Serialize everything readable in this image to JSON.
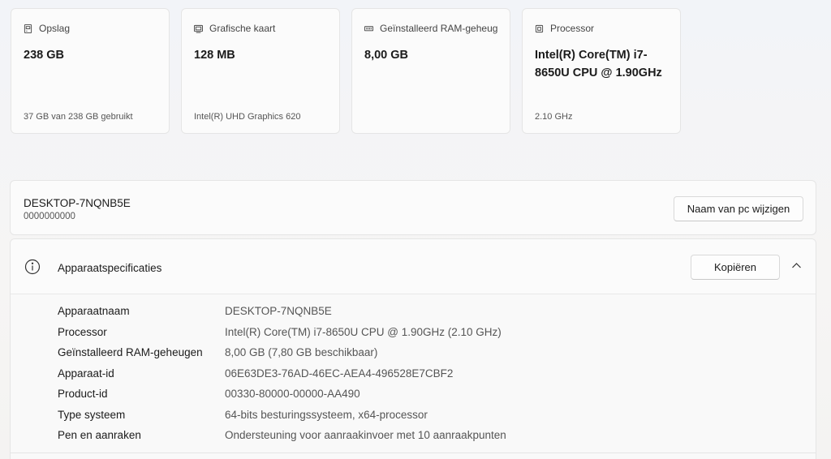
{
  "cards": [
    {
      "icon": "storage-icon",
      "title": "Opslag",
      "value": "238 GB",
      "sub": "37 GB van 238 GB gebruikt"
    },
    {
      "icon": "graphics-card-icon",
      "title": "Grafische kaart",
      "value": "128 MB",
      "sub": "Intel(R) UHD Graphics 620"
    },
    {
      "icon": "ram-icon",
      "title": "Geïnstalleerd RAM-geheug",
      "value": "8,00 GB",
      "sub": ""
    },
    {
      "icon": "processor-icon",
      "title": "Processor",
      "value": "Intel(R) Core(TM) i7-8650U CPU @ 1.90GHz",
      "sub": "2.10 GHz"
    }
  ],
  "pc": {
    "name": "DESKTOP-7NQNB5E",
    "id": "0000000000",
    "rename_label": "Naam van pc wijzigen"
  },
  "specs": {
    "title": "Apparaatspecificaties",
    "copy_label": "Kopiëren",
    "rows": [
      {
        "label": "Apparaatnaam",
        "value": "DESKTOP-7NQNB5E"
      },
      {
        "label": "Processor",
        "value": "Intel(R) Core(TM) i7-8650U CPU @ 1.90GHz (2.10 GHz)"
      },
      {
        "label": "Geïnstalleerd RAM-geheugen",
        "value": "8,00 GB (7,80 GB beschikbaar)"
      },
      {
        "label": "Apparaat-id",
        "value": "06E63DE3-76AD-46EC-AEA4-496528E7CBF2"
      },
      {
        "label": "Product-id",
        "value": "00330-80000-00000-AA490"
      },
      {
        "label": "Type systeem",
        "value": "64-bits besturingssysteem, x64-processor"
      },
      {
        "label": "Pen en aanraken",
        "value": "Ondersteuning voor aanraakinvoer met 10 aanraakpunten"
      }
    ]
  }
}
